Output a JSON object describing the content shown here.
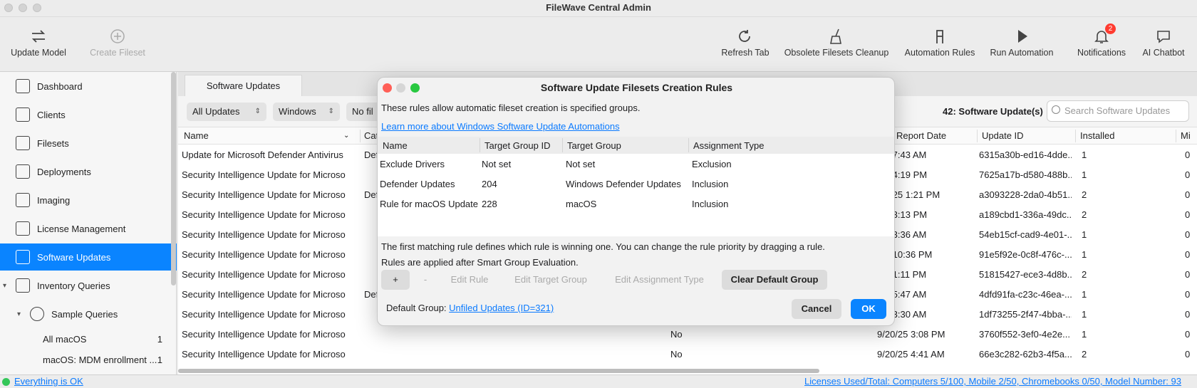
{
  "window": {
    "title": "FileWave Central Admin"
  },
  "toolbar": {
    "update_model": "Update Model",
    "create_fileset": "Create Fileset",
    "refresh_tab": "Refresh Tab",
    "obsolete_cleanup": "Obsolete Filesets Cleanup",
    "automation_rules": "Automation Rules",
    "run_automation": "Run Automation",
    "notifications": "Notifications",
    "notifications_count": "2",
    "ai_chatbot": "AI Chatbot"
  },
  "sidebar": {
    "items": [
      {
        "label": "Dashboard"
      },
      {
        "label": "Clients"
      },
      {
        "label": "Filesets"
      },
      {
        "label": "Deployments"
      },
      {
        "label": "Imaging"
      },
      {
        "label": "License Management"
      },
      {
        "label": "Software Updates"
      },
      {
        "label": "Inventory Queries"
      }
    ],
    "sample_queries": "Sample Queries",
    "queries": [
      {
        "label": "All macOS",
        "count": "1"
      },
      {
        "label": "macOS: MDM enrollment ...",
        "count": "1"
      }
    ]
  },
  "main": {
    "tab": "Software Updates",
    "filter_updates": "All Updates",
    "filter_platform": "Windows",
    "filter_third": "No fil",
    "count_label": "42: Software Update(s)",
    "search_placeholder": "Search Software Updates",
    "columns": {
      "name": "Name",
      "category": "Cat",
      "report_date": "Report Date",
      "update_id": "Update ID",
      "installed": "Installed",
      "missing": "Mi"
    },
    "rows": [
      {
        "name": "Update for Microsoft Defender Antivirus ...",
        "cat": "Def",
        "flag": "",
        "date": "/25 7:43 AM",
        "id": "6315a30b-ed16-4dde...",
        "installed": "1",
        "missing": "0"
      },
      {
        "name": "Security Intelligence Update for Microsof...",
        "cat": "",
        "flag": "",
        "date": "/25 4:19 PM",
        "id": "7625a17b-d580-488b...",
        "installed": "1",
        "missing": "0"
      },
      {
        "name": "Security Intelligence Update for Microsof...",
        "cat": "Def",
        "flag": "",
        "date": "/20/25 1:21 PM",
        "id": "a3093228-2da0-4b51...",
        "installed": "2",
        "missing": "0"
      },
      {
        "name": "Security Intelligence Update for Microsof...",
        "cat": "",
        "flag": "",
        "date": "/25 3:13 PM",
        "id": "a189cbd1-336a-49dc...",
        "installed": "2",
        "missing": "0"
      },
      {
        "name": "Security Intelligence Update for Microsof...",
        "cat": "",
        "flag": "",
        "date": "/25 3:36 AM",
        "id": "54eb15cf-cad9-4e01-...",
        "installed": "1",
        "missing": "0"
      },
      {
        "name": "Security Intelligence Update for Microsof...",
        "cat": "",
        "flag": "",
        "date": "/25 10:36 PM",
        "id": "91e5f92e-0c8f-476c-...",
        "installed": "1",
        "missing": "0"
      },
      {
        "name": "Security Intelligence Update for Microsof...",
        "cat": "",
        "flag": "",
        "date": "/25 1:11 PM",
        "id": "51815427-ece3-4d8b...",
        "installed": "2",
        "missing": "0"
      },
      {
        "name": "Security Intelligence Update for Microsof...",
        "cat": "Def",
        "flag": "",
        "date": "/25 5:47 AM",
        "id": "4dfd91fa-c23c-46ea-...",
        "installed": "1",
        "missing": "0"
      },
      {
        "name": "Security Intelligence Update for Microsof...",
        "cat": "",
        "flag": "",
        "date": "/25 3:30 AM",
        "id": "1df73255-2f47-4bba-...",
        "installed": "1",
        "missing": "0"
      },
      {
        "name": "Security Intelligence Update for Microsof...",
        "cat": "",
        "flag": "No",
        "date": "9/20/25 3:08 PM",
        "id": "3760f552-3ef0-4e2e...",
        "installed": "1",
        "missing": "0"
      },
      {
        "name": "Security Intelligence Update for Microsof...",
        "cat": "",
        "flag": "No",
        "date": "9/20/25 4:41 AM",
        "id": "66e3c282-62b3-4f5a...",
        "installed": "2",
        "missing": "0"
      }
    ]
  },
  "status": {
    "left": "Everything is OK",
    "right": "Licenses Used/Total: Computers 5/100, Mobile 2/50, Chromebooks 0/50, Model Number: 93"
  },
  "dialog": {
    "title": "Software Update Filesets Creation Rules",
    "description": "These rules allow automatic fileset creation is specified groups.",
    "learn_more": "Learn more about Windows Software Update Automations",
    "columns": {
      "name": "Name",
      "target_id": "Target Group ID",
      "target_group": "Target Group",
      "assignment": "Assignment Type"
    },
    "rules": [
      {
        "name": "Exclude Drivers",
        "target_id": "Not set",
        "target_group": "Not set",
        "assignment": "Exclusion"
      },
      {
        "name": "Defender Updates",
        "target_id": "204",
        "target_group": "Windows Defender Updates",
        "assignment": "Inclusion"
      },
      {
        "name": "Rule for macOS Update",
        "target_id": "228",
        "target_group": "macOS",
        "assignment": "Inclusion"
      }
    ],
    "note1": "The first matching rule defines which rule is winning one. You can change the rule priority by dragging a rule.",
    "note2": "Rules are applied after Smart Group Evaluation.",
    "btn_add": "+",
    "btn_remove": "-",
    "btn_edit_rule": "Edit Rule",
    "btn_edit_target": "Edit Target Group",
    "btn_edit_assignment": "Edit Assignment Type",
    "btn_clear_default": "Clear Default Group",
    "default_group_label": "Default Group:",
    "default_group_value": "Unfiled Updates (ID=321)",
    "cancel": "Cancel",
    "ok": "OK"
  }
}
